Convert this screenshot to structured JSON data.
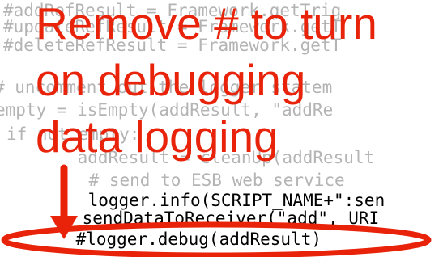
{
  "code_lines": [
    "#addRefResult = Framework.getTrig",
    "#updateRefResult = Framework.getT",
    "#deleteRefResult = Framework.getT",
    "",
    "# uncomment out the logger statem",
    "empty = isEmpty(addResult, \"addRe",
    "if not empty:",
    "    addResult = cleanUp(addResult",
    "    # send to ESB web service",
    "    logger.info(SCRIPT_NAME+\":sen",
    "    sendDataToReceiver(\"add\", URI",
    "    #logger.debug(addResult)"
  ],
  "annotation": {
    "line1": "Remove # to turn",
    "line2": "on debugging",
    "line3": "data logging"
  },
  "colors": {
    "annotation": "#e8230a",
    "faded_code": "#b4b4b4",
    "code": "#000000"
  }
}
